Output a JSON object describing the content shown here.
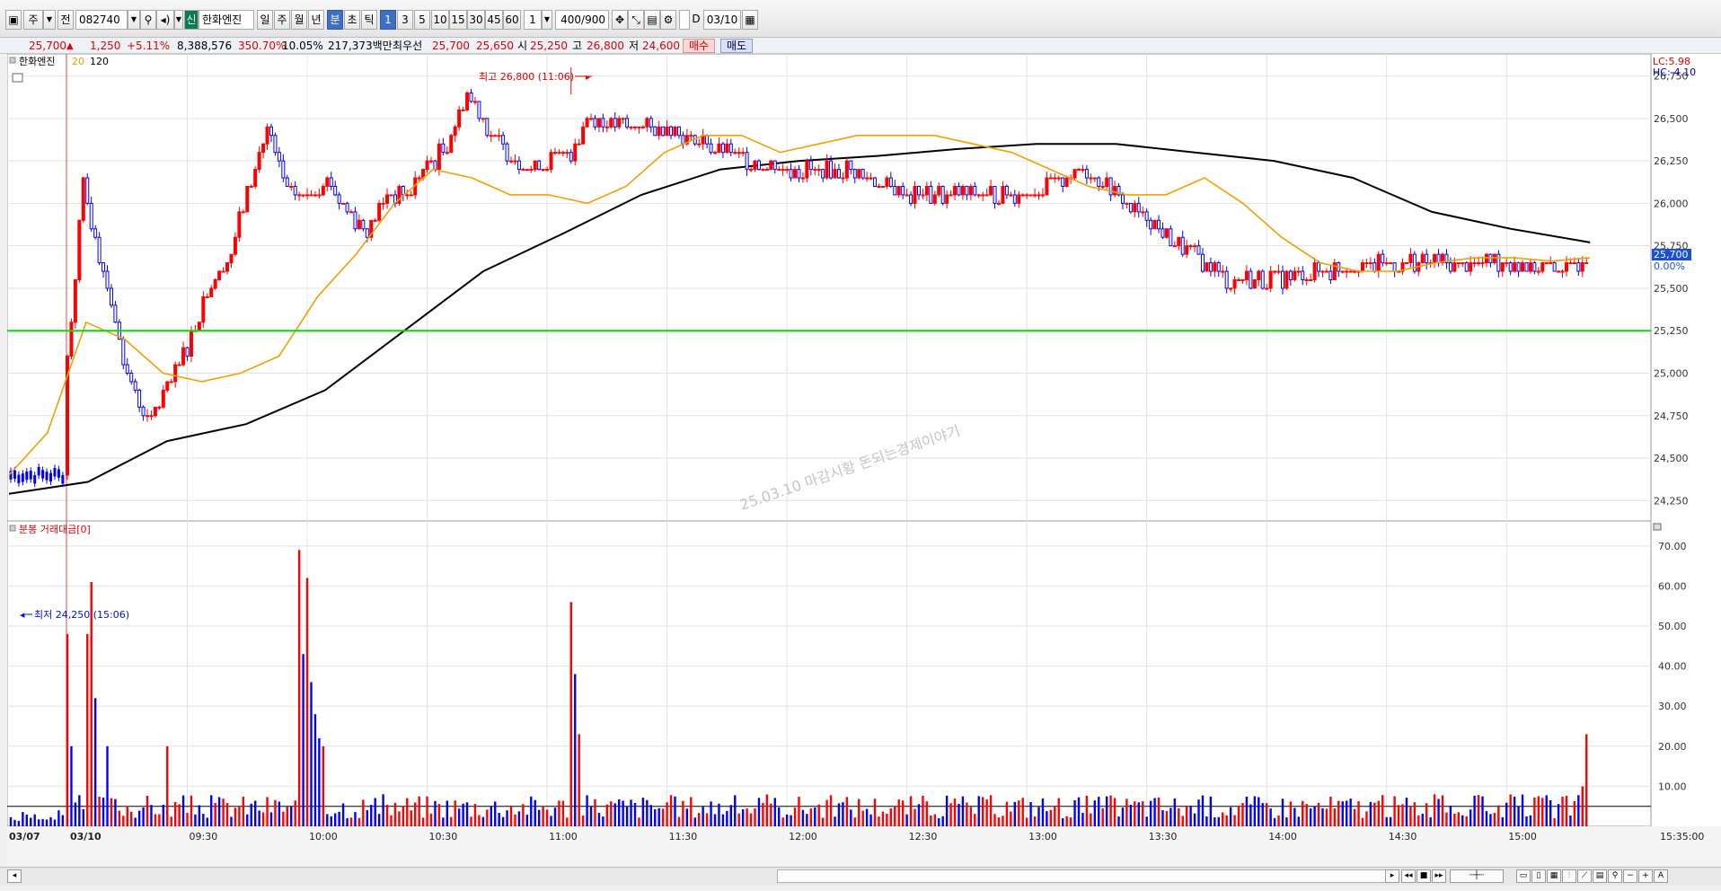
{
  "toolbar": {
    "period_label": "주",
    "prev_label": "전",
    "code": "082740",
    "badge_label": "신",
    "stock_name": "한화엔진",
    "period_buttons": [
      "일",
      "주",
      "월",
      "년",
      "분",
      "초",
      "틱"
    ],
    "interval_buttons": [
      "1",
      "3",
      "5",
      "10",
      "15",
      "30",
      "45",
      "60"
    ],
    "unit_value": "1",
    "count_value": "400/900",
    "d_label": "D",
    "date_value": "03/10"
  },
  "quote": {
    "price": "25,700",
    "change": "1,250",
    "change_pct": "+5.11%",
    "volume": "8,388,576",
    "volume_pct": "350.70%",
    "turnover": "10.05%",
    "amount": "217,373백만",
    "best_label": "최우선",
    "ask": "25,700",
    "bid": "25,650",
    "open_label": "시",
    "open": "25,250",
    "high_label": "고",
    "high": "26,800",
    "low_label": "저",
    "low": "24,600",
    "buy_label": "매수",
    "sell_label": "매도"
  },
  "legend": {
    "name": "한화엔진",
    "ma_short": "20",
    "ma_long": "120",
    "lc": "LC:5.98",
    "hc": "HC:-4.10",
    "price_tag": "25,700",
    "pct_tag": "0.00%",
    "volume_title": "분봉 거래대금[0]"
  },
  "annotations": {
    "high": "최고 26,800 (11:06)",
    "low": "최저 24,250 (15:06)",
    "watermark": "25.03.10 마감시황 돈되는경제이야기"
  },
  "colors": {
    "up": "#ff0000",
    "down": "#0000ff",
    "ma20": "#f0a000",
    "ma120": "#000000",
    "reference": "#00dd00"
  },
  "chart_data": [
    {
      "type": "candlestick",
      "interval": "1 minute",
      "x_labels": [
        "03/07",
        "03/10",
        "09:30",
        "10:00",
        "10:30",
        "11:00",
        "11:30",
        "12:00",
        "12:30",
        "13:00",
        "13:30",
        "14:00",
        "14:30",
        "15:00",
        "15:35:00"
      ],
      "yticks": [
        24250,
        24500,
        24750,
        25000,
        25250,
        25500,
        25750,
        26000,
        26250,
        26500,
        26750
      ],
      "ylabels": [
        "24,250",
        "24,500",
        "24,750",
        "25,000",
        "25,250",
        "25,500",
        "25,750",
        "26,000",
        "26,250",
        "26,500",
        "26,750"
      ],
      "ylim": [
        24130,
        26880
      ],
      "reference_line": 25250,
      "series_close": {
        "x": [
          "03/07 end",
          "09:00",
          "09:04",
          "09:10",
          "09:15",
          "09:20",
          "09:25",
          "09:30",
          "09:35",
          "09:40",
          "09:45",
          "09:50",
          "09:55",
          "10:00",
          "10:05",
          "10:10",
          "10:15",
          "10:20",
          "10:25",
          "10:30",
          "10:35",
          "10:40",
          "10:45",
          "10:50",
          "10:55",
          "11:00",
          "11:06",
          "11:10",
          "11:20",
          "11:30",
          "11:40",
          "11:50",
          "12:00",
          "12:15",
          "12:30",
          "12:45",
          "13:00",
          "13:15",
          "13:30",
          "13:45",
          "13:50",
          "14:00",
          "14:15",
          "14:30",
          "14:45",
          "15:00",
          "15:15",
          "15:20"
        ],
        "values": [
          24400,
          25100,
          26100,
          25500,
          25000,
          24700,
          24900,
          25150,
          25500,
          25650,
          26050,
          26450,
          26050,
          26050,
          26150,
          25950,
          25850,
          26050,
          26050,
          26200,
          26350,
          26650,
          26450,
          26300,
          26200,
          26250,
          26300,
          26500,
          26450,
          26450,
          26350,
          26250,
          26200,
          26200,
          26050,
          26050,
          26050,
          26200,
          25900,
          25650,
          25550,
          25550,
          25600,
          25650,
          25650,
          25650,
          25600,
          25700
        ]
      },
      "ma20": [
        24400,
        24650,
        25300,
        25200,
        25000,
        24950,
        25000,
        25100,
        25450,
        25700,
        26000,
        26200,
        26150,
        26050,
        26050,
        26000,
        26100,
        26300,
        26400,
        26400,
        26300,
        26350,
        26400,
        26400,
        26400,
        26350,
        26300,
        26200,
        26100,
        26050,
        26050,
        26150,
        26000,
        25800,
        25650,
        25600,
        25600,
        25650,
        25680,
        25680,
        25660,
        25680
      ],
      "ma120": [
        24290,
        24360,
        24600,
        24700,
        24900,
        25250,
        25600,
        25820,
        26050,
        26200,
        26250,
        26280,
        26320,
        26350,
        26350,
        26300,
        26250,
        26150,
        25950,
        25850,
        25770
      ],
      "high_point": {
        "time": "11:06",
        "value": 26800
      },
      "low_point": {
        "time": "15:06",
        "value": 24250
      }
    },
    {
      "type": "bar",
      "title": "분봉 거래대금[0]",
      "yticks": [
        10,
        20,
        30,
        40,
        50,
        60,
        70
      ],
      "ylabels": [
        "10.00",
        "20.00",
        "30.00",
        "40.00",
        "50.00",
        "60.00",
        "70.00"
      ],
      "ylim": [
        0,
        74
      ],
      "reference_line": 5,
      "series": [
        {
          "x": [
            "09:00",
            "09:01",
            "09:05",
            "09:06",
            "09:07",
            "09:10",
            "09:25",
            "09:58",
            "09:59",
            "10:00",
            "10:01",
            "10:02",
            "10:03",
            "10:04",
            "11:06",
            "11:07",
            "11:08",
            "15:19",
            "15:20"
          ],
          "values": [
            48,
            20,
            48,
            61,
            32,
            20,
            20,
            69,
            43,
            62,
            36,
            28,
            22,
            20,
            56,
            38,
            23,
            10,
            23
          ],
          "colors": [
            "#ff0000",
            "#0000ff",
            "#ff0000",
            "#ff0000",
            "#0000ff",
            "#0000ff",
            "#ff0000",
            "#ff0000",
            "#0000ff",
            "#ff0000",
            "#0000ff",
            "#0000ff",
            "#0000ff",
            "#ff0000",
            "#ff0000",
            "#0000ff",
            "#ff0000",
            "#ff0000",
            "#ff0000"
          ]
        }
      ]
    }
  ]
}
